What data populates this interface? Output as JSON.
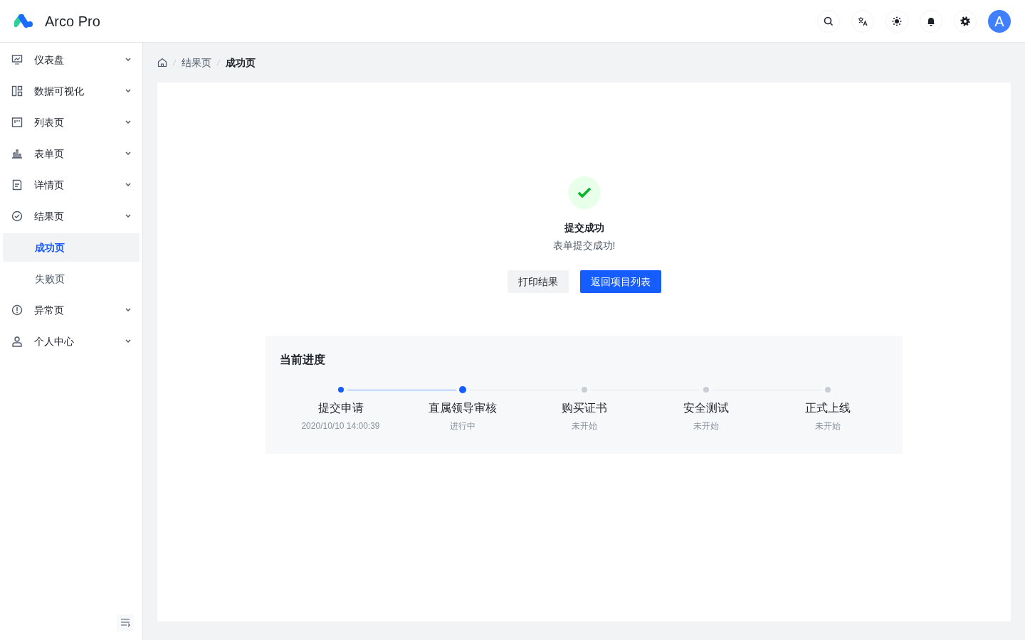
{
  "header": {
    "logo_text": "Arco Pro",
    "avatar": "A"
  },
  "sidebar": {
    "items": [
      {
        "label": "仪表盘"
      },
      {
        "label": "数据可视化"
      },
      {
        "label": "列表页"
      },
      {
        "label": "表单页"
      },
      {
        "label": "详情页"
      },
      {
        "label": "结果页",
        "children": [
          {
            "label": "成功页",
            "selected": true
          },
          {
            "label": "失败页",
            "selected": false
          }
        ]
      },
      {
        "label": "异常页"
      },
      {
        "label": "个人中心"
      }
    ]
  },
  "breadcrumb": [
    "结果页",
    "成功页"
  ],
  "result": {
    "title": "提交成功",
    "subtitle": "表单提交成功!",
    "buttons": [
      {
        "label": "打印结果",
        "kind": "secondary"
      },
      {
        "label": "返回项目列表",
        "kind": "primary"
      }
    ]
  },
  "progress": {
    "title": "当前进度",
    "steps": [
      {
        "title": "提交申请",
        "description": "2020/10/10 14:00:39",
        "kind": "finish"
      },
      {
        "title": "直属领导审核",
        "description": "进行中",
        "kind": "process"
      },
      {
        "title": "购买证书",
        "description": "未开始",
        "kind": "wait"
      },
      {
        "title": "安全测试",
        "description": "未开始",
        "kind": "wait"
      },
      {
        "title": "正式上线",
        "description": "未开始",
        "kind": "wait"
      }
    ]
  }
}
